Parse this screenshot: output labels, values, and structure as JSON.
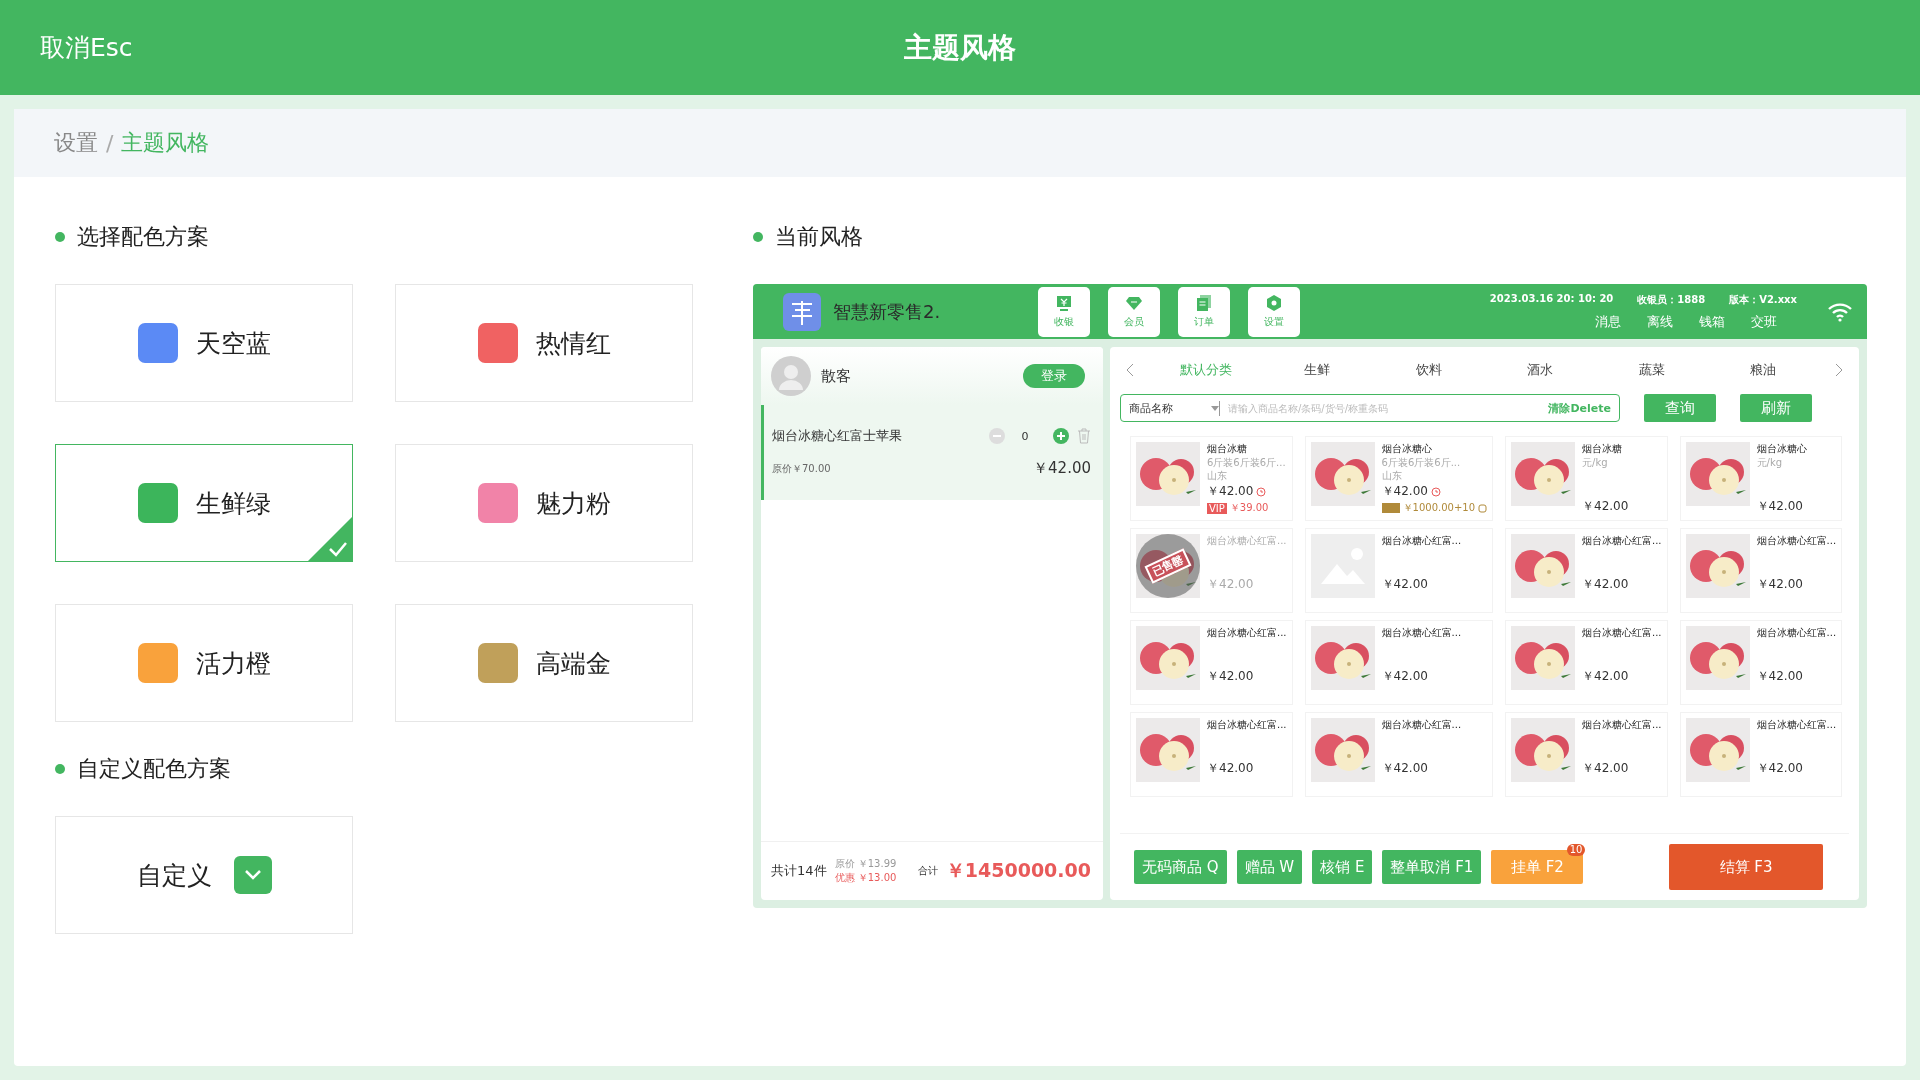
{
  "top_bar": {
    "cancel": "取消Esc",
    "title": "主题风格"
  },
  "breadcrumb": {
    "separator": "/",
    "items": [
      {
        "label": "设置",
        "current": false
      },
      {
        "label": "主题风格",
        "current": true
      }
    ]
  },
  "schemes": {
    "heading": "选择配色方案",
    "items": [
      {
        "name": "天空蓝",
        "color": "#5b8af5",
        "selected": false
      },
      {
        "name": "热情红",
        "color": "#f06262",
        "selected": false
      },
      {
        "name": "生鲜绿",
        "color": "#3cb55b",
        "selected": true
      },
      {
        "name": "魅力粉",
        "color": "#f183a8",
        "selected": false
      },
      {
        "name": "活力橙",
        "color": "#f9a23c",
        "selected": false
      },
      {
        "name": "高端金",
        "color": "#c0a05a",
        "selected": false
      }
    ]
  },
  "custom": {
    "heading": "自定义配色方案",
    "label": "自定义"
  },
  "preview": {
    "heading": "当前风格",
    "app_name": "智慧新零售2.",
    "nav": [
      {
        "label": "收银",
        "kind": "cash"
      },
      {
        "label": "会员",
        "kind": "member"
      },
      {
        "label": "订单",
        "kind": "order"
      },
      {
        "label": "设置",
        "kind": "settings"
      }
    ],
    "info": [
      "2023.03.16 20: 10: 20",
      "收银员：1888",
      "版本：V2.xxx"
    ],
    "links": [
      "消息",
      "离线",
      "钱箱",
      "交班"
    ],
    "customer": {
      "name": "散客",
      "login": "登录"
    },
    "cart": [
      {
        "name": "烟台冰糖心红富士苹果",
        "qty": "0",
        "original": "原价￥70.00",
        "price": "￥42.00",
        "selected": true
      }
    ],
    "footer": {
      "count": "共计14件",
      "original": "原价 ￥13.99",
      "discount": "优惠 ￥13.00",
      "total_label": "合计",
      "total": "￥1450000.00"
    },
    "categories": [
      {
        "label": "默认分类",
        "selected": true
      },
      {
        "label": "生鲜",
        "selected": false
      },
      {
        "label": "饮料",
        "selected": false
      },
      {
        "label": "酒水",
        "selected": false
      },
      {
        "label": "蔬菜",
        "selected": false
      },
      {
        "label": "粮油",
        "selected": false
      }
    ],
    "search": {
      "field": "商品名称",
      "placeholder": "请输入商品名称/条码/货号/称重条码",
      "clear": "清除Delete",
      "buttons": [
        "查询",
        "刷新"
      ]
    },
    "products": [
      {
        "name": "烟台冰糖",
        "desc": "6斤装6斤装6斤...",
        "origin": "山东",
        "price": "￥42.00",
        "timed": true,
        "kind": "apple",
        "sold_out": false,
        "promo": {
          "kind": "vip",
          "tag": "VIP",
          "price": "￥39.00"
        }
      },
      {
        "name": "烟台冰糖心",
        "desc": "6斤装6斤装6斤...",
        "origin": "山东",
        "price": "￥42.00",
        "timed": true,
        "kind": "apple",
        "sold_out": false,
        "promo": {
          "kind": "points",
          "price": "￥1000.00+10"
        }
      },
      {
        "name": "烟台冰糖",
        "desc": "元/kg",
        "price": "￥42.00",
        "timed": false,
        "kind": "apple",
        "sold_out": false
      },
      {
        "name": "烟台冰糖心",
        "desc": "元/kg",
        "price": "￥42.00",
        "timed": false,
        "kind": "apple",
        "sold_out": false
      },
      {
        "name": "烟台冰糖心红富...",
        "price": "￥42.00",
        "timed": false,
        "kind": "apple",
        "sold_out": true,
        "stamp": "已售罄"
      },
      {
        "name": "烟台冰糖心红富...",
        "price": "￥42.00",
        "timed": false,
        "kind": "placeholder",
        "sold_out": false
      },
      {
        "name": "烟台冰糖心红富...",
        "price": "￥42.00",
        "timed": false,
        "kind": "apple",
        "sold_out": false
      },
      {
        "name": "烟台冰糖心红富...",
        "price": "￥42.00",
        "timed": false,
        "kind": "apple",
        "sold_out": false
      },
      {
        "name": "烟台冰糖心红富...",
        "price": "￥42.00",
        "timed": false,
        "kind": "apple",
        "sold_out": false
      },
      {
        "name": "烟台冰糖心红富...",
        "price": "￥42.00",
        "timed": false,
        "kind": "apple",
        "sold_out": false
      },
      {
        "name": "烟台冰糖心红富...",
        "price": "￥42.00",
        "timed": false,
        "kind": "apple",
        "sold_out": false
      },
      {
        "name": "烟台冰糖心红富...",
        "price": "￥42.00",
        "timed": false,
        "kind": "apple",
        "sold_out": false
      },
      {
        "name": "烟台冰糖心红富...",
        "price": "￥42.00",
        "timed": false,
        "kind": "apple",
        "sold_out": false
      },
      {
        "name": "烟台冰糖心红富...",
        "price": "￥42.00",
        "timed": false,
        "kind": "apple",
        "sold_out": false
      },
      {
        "name": "烟台冰糖心红富...",
        "price": "￥42.00",
        "timed": false,
        "kind": "apple",
        "sold_out": false
      },
      {
        "name": "烟台冰糖心红富...",
        "price": "￥42.00",
        "timed": false,
        "kind": "apple",
        "sold_out": false
      }
    ],
    "actions": [
      {
        "label": "无码商品 Q",
        "kind": "normal"
      },
      {
        "label": "赠品 W",
        "kind": "normal"
      },
      {
        "label": "核销 E",
        "kind": "normal"
      },
      {
        "label": "整单取消 F1",
        "kind": "normal"
      },
      {
        "label": "挂单 F2",
        "kind": "hold",
        "badge": "10"
      },
      {
        "label": "结算 F3",
        "kind": "checkout"
      }
    ]
  }
}
